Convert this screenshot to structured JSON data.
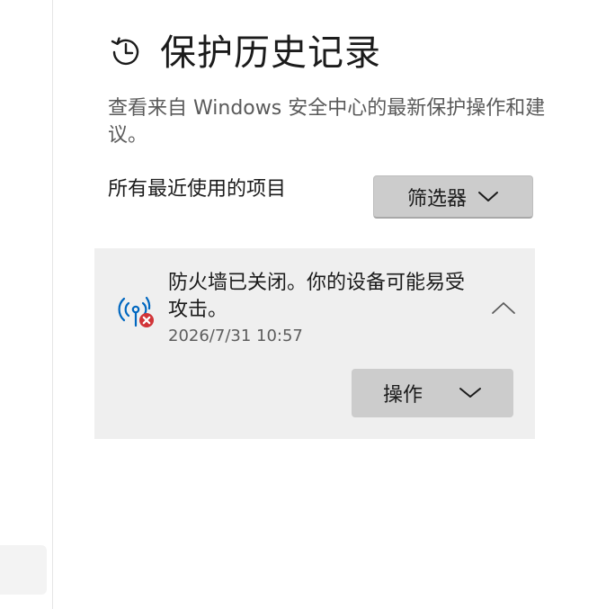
{
  "page": {
    "title": "保护历史记录",
    "description": "查看来自 Windows 安全中心的最新保护操作和建议。",
    "section_label": "所有最近使用的项目",
    "filter_label": "筛选器"
  },
  "card": {
    "title": "防火墙已关闭。你的设备可能易受攻击。",
    "timestamp": "2026/7/31 10:57",
    "action_label": "操作",
    "icon": "firewall-off-icon",
    "status_color": "#d13438",
    "icon_color": "#0067c0"
  },
  "icons": {
    "header": "history-clock-icon",
    "filter": "chevron-down-icon",
    "collapse": "chevron-up-icon",
    "action": "chevron-down-icon"
  }
}
